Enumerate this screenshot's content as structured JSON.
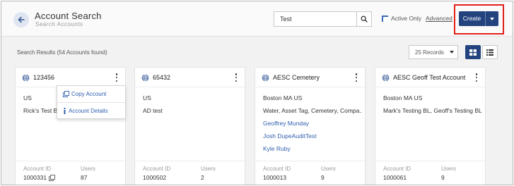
{
  "header": {
    "title": "Account Search",
    "subtitle": "Search Accounts",
    "search_value": "Test",
    "active_only_label": "Active Only",
    "active_only_checked": true,
    "advanced_label": "Advanced",
    "create_label": "Create"
  },
  "results": {
    "summary": "Search Results (54 Accounts found)",
    "records_per_page": "25 Records",
    "view_mode": "grid"
  },
  "menu": {
    "copy_account": "Copy Account",
    "account_details": "Account Details"
  },
  "footer_labels": {
    "account_id": "Account ID",
    "users": "Users"
  },
  "cards": [
    {
      "name": "123456",
      "line1": "US",
      "line2": "Rick's Test Bl",
      "account_id": "1000331",
      "users": "87"
    },
    {
      "name": "65432",
      "line1": "US",
      "line2": "AD test",
      "account_id": "1000502",
      "users": "2"
    },
    {
      "name": "AESC Cemetery",
      "line1": "Boston MA US",
      "line2": "Water, Asset Tag, Cemetery, Compa...",
      "contacts": [
        "Geoffrey Munday",
        "Josh DupeAuditTest",
        "Kyle Ruby"
      ],
      "account_id": "1000013",
      "users": "9"
    },
    {
      "name": "AESC Geoff Test Account",
      "line1": "Boston MA US",
      "line2": "Mark's Testing BL, Geoff's Testing BL",
      "account_id": "1000061",
      "users": "9"
    }
  ],
  "colors": {
    "primary": "#23437f",
    "link": "#2f5fae",
    "highlight": "#e0201b"
  }
}
